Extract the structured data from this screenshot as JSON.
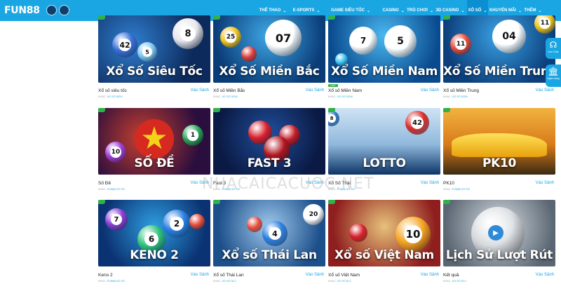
{
  "brand": {
    "logo": "FUN88",
    "accent": "#1aa6e3"
  },
  "nav": {
    "items": [
      {
        "label": "THỂ THAO",
        "hot": "",
        "active": false
      },
      {
        "label": "E-SPORTS",
        "hot": "",
        "active": false
      },
      {
        "label": "GAME SIÊU TỐC",
        "hot": "",
        "active": false
      },
      {
        "label": "CASINO",
        "hot": "",
        "active": false
      },
      {
        "label": "TRÒ CHƠI",
        "hot": "",
        "active": false
      },
      {
        "label": "3D CASINO",
        "hot": "",
        "active": false
      },
      {
        "label": "XỔ SỐ",
        "hot": "",
        "active": true
      },
      {
        "label": "KHUYẾN MÃI",
        "hot": "",
        "active": false
      },
      {
        "label": "THÊM",
        "hot": "",
        "active": false
      }
    ]
  },
  "games": [
    {
      "thumb_title": "Xổ Số Siêu Tốc",
      "name": "Xổ số siêu tốc",
      "sub": "KHÁC,",
      "provider": "XỔ SỐ SIÊU",
      "link": "Vào Sảnh",
      "live": ""
    },
    {
      "thumb_title": "Xổ Số Miền Bắc",
      "name": "Xổ số Miền Bắc",
      "sub": "KHÁC,",
      "provider": "XỔ SỐ SGW",
      "link": "Vào Sảnh",
      "live": ""
    },
    {
      "thumb_title": "Xổ Số Miền Nam",
      "name": "Xổ số Miền Nam",
      "sub": "KHÁC,",
      "provider": "XỔ SỐ SGW",
      "link": "Vào Sảnh",
      "live": "LIVE"
    },
    {
      "thumb_title": "Xổ Số Miền Trung",
      "name": "Xổ số Miền Trung",
      "sub": "KHÁC,",
      "provider": "XỔ SỐ SGW",
      "link": "Vào Sảnh",
      "live": ""
    },
    {
      "thumb_title": "SỐ ĐỀ",
      "name": "Số Đề",
      "sub": "KHÁC,",
      "provider": "FUN88 XỔ SỐ",
      "link": "Vào Sảnh",
      "live": ""
    },
    {
      "thumb_title": "FAST 3",
      "name": "Fast 3",
      "sub": "KHÁC,",
      "provider": "FUN88 XỔ SỐ",
      "link": "Vào Sảnh",
      "live": ""
    },
    {
      "thumb_title": "LOTTO",
      "name": "Xổ Số Thái",
      "sub": "KHÁC,",
      "provider": "FUN88 XỔ SỐ",
      "link": "Vào Sảnh",
      "live": ""
    },
    {
      "thumb_title": "PK10",
      "name": "PK10",
      "sub": "KHÁC,",
      "provider": "FUN88 XỔ SỐ",
      "link": "Vào Sảnh",
      "live": ""
    },
    {
      "thumb_title": "KENO 2",
      "name": "Keno 2",
      "sub": "KHÁC,",
      "provider": "FUN88 XỔ SỐ",
      "link": "Vào Sảnh",
      "live": ""
    },
    {
      "thumb_title": "Xổ số Thái Lan",
      "name": "Xổ số Thái Lan",
      "sub": "KHÁC,",
      "provider": "XỔ SỐ SLC",
      "link": "Vào Sảnh",
      "live": ""
    },
    {
      "thumb_title": "Xổ số Việt Nam",
      "name": "Xổ số Việt Nam",
      "sub": "KHÁC,",
      "provider": "XỔ SỐ SLC",
      "link": "Vào Sảnh",
      "live": ""
    },
    {
      "thumb_title": "Lịch Sử Lượt Rút",
      "name": "Kết quả",
      "sub": "KHÁC,",
      "provider": "XỔ SỐ SLC",
      "link": "Vào Sảnh",
      "live": ""
    }
  ],
  "side": [
    {
      "icon": "headset-icon",
      "label": "Live Chat"
    },
    {
      "icon": "bank-icon",
      "label": "Ngân hàng"
    }
  ],
  "watermark": "NHACAICACUOC.NET"
}
